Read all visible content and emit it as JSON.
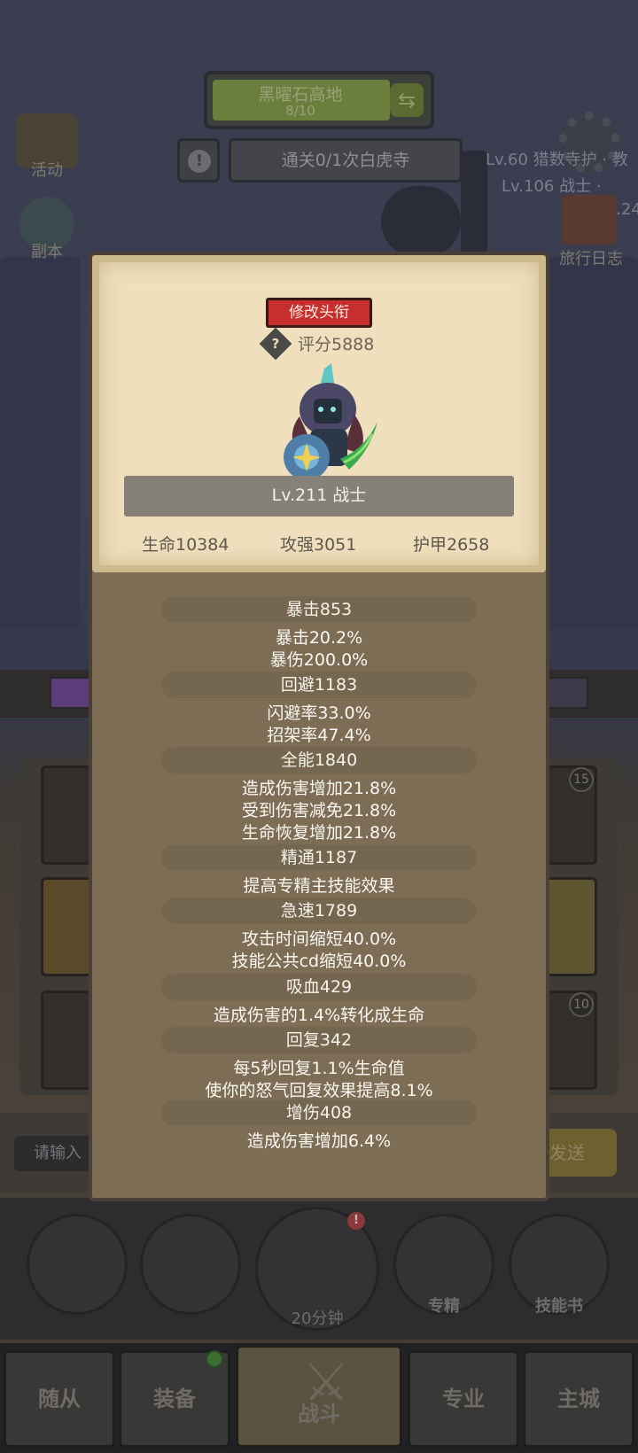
{
  "background": {
    "stage": {
      "name": "黑曜石高地",
      "progress": "8/10"
    },
    "quest": "通关0/1次白虎寺",
    "left_icons": [
      "活动",
      "副本"
    ],
    "right_texts": [
      "Lv.60 猎数寺护 · 教",
      "Lv.106 战士 ·",
      "Lv.24"
    ],
    "travel_log": "旅行日志",
    "chat": {
      "placeholder": "请输入",
      "send": "发送"
    },
    "tile_badges": [
      "15",
      "10"
    ],
    "actions": {
      "chest_timer": "20分钟",
      "specialize": "专精",
      "skill_book": "技能书",
      "chest_badge": "!"
    },
    "nav": {
      "followers": "随从",
      "equipment": "装备",
      "battle": "战斗",
      "profession": "专业",
      "main_city": "主城"
    }
  },
  "character": {
    "rename_button": "修改头衔",
    "score_icon": "?",
    "score": "评分5888",
    "level_class": "Lv.211 战士",
    "base_stats": {
      "hp": "生命10384",
      "attack": "攻强3051",
      "armor": "护甲2658"
    }
  },
  "stats": [
    {
      "title": "暴击853",
      "lines": [
        "暴击20.2%",
        "暴伤200.0%"
      ]
    },
    {
      "title": "回避1183",
      "lines": [
        "闪避率33.0%",
        "招架率47.4%"
      ]
    },
    {
      "title": "全能1840",
      "lines": [
        "造成伤害增加21.8%",
        "受到伤害减免21.8%",
        "生命恢复增加21.8%"
      ]
    },
    {
      "title": "精通1187",
      "lines": [
        "提高专精主技能效果"
      ]
    },
    {
      "title": "急速1789",
      "lines": [
        "攻击时间缩短40.0%",
        "技能公共cd缩短40.0%"
      ]
    },
    {
      "title": "吸血429",
      "lines": [
        "造成伤害的1.4%转化成生命"
      ]
    },
    {
      "title": "回复342",
      "lines": [
        "每5秒回复1.1%生命值",
        "使你的怒气回复效果提高8.1%"
      ]
    },
    {
      "title": "增伤408",
      "lines": [
        "造成伤害增加6.4%"
      ]
    }
  ]
}
